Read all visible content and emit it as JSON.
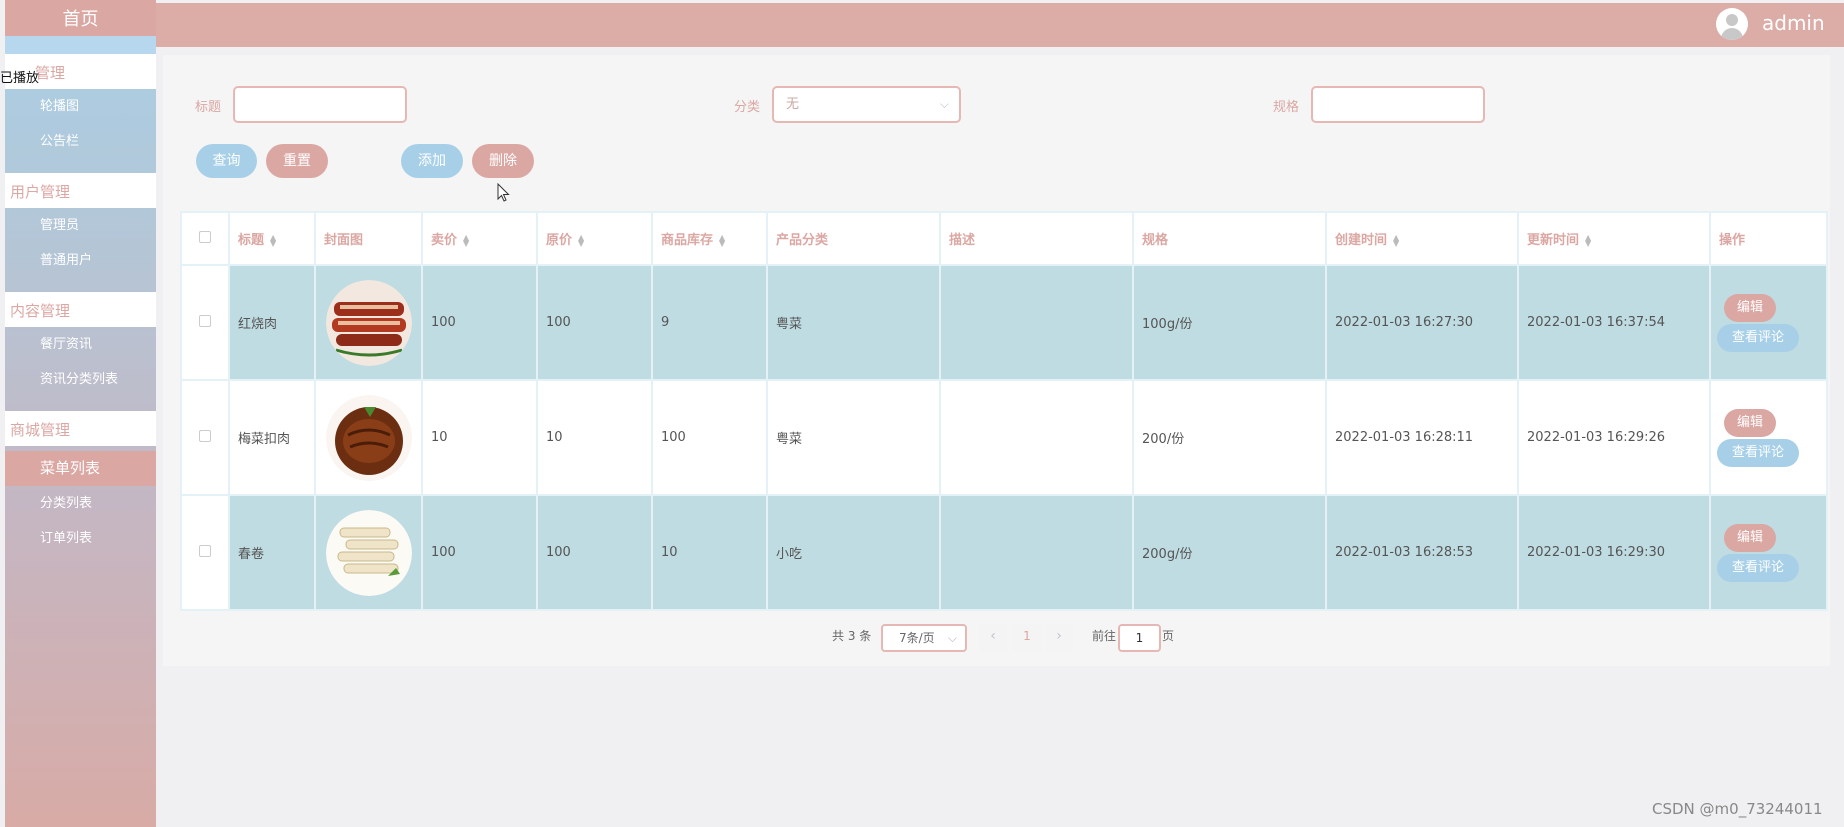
{
  "sidebar": {
    "home": "首页",
    "overlay_text": "已播放",
    "groups": [
      {
        "label": "管理",
        "items": [
          "轮播图",
          "公告栏"
        ]
      },
      {
        "label": "用户管理",
        "items": [
          "管理员",
          "普通用户"
        ]
      },
      {
        "label": "内容管理",
        "items": [
          "餐厅资讯",
          "资讯分类列表"
        ]
      },
      {
        "label": "商城管理",
        "items": [
          "菜单列表",
          "分类列表",
          "订单列表"
        ]
      }
    ],
    "active_item": "菜单列表"
  },
  "header": {
    "username": "admin"
  },
  "filters": {
    "title_label": "标题",
    "title_value": "",
    "category_label": "分类",
    "category_value": "无",
    "spec_label": "规格",
    "spec_value": ""
  },
  "buttons": {
    "query": "查询",
    "reset": "重置",
    "add": "添加",
    "delete": "删除"
  },
  "table": {
    "columns": [
      "标题",
      "封面图",
      "卖价",
      "原价",
      "商品库存",
      "产品分类",
      "描述",
      "规格",
      "创建时间",
      "更新时间",
      "操作"
    ],
    "rows": [
      {
        "title": "红烧肉",
        "sell_price": "100",
        "orig_price": "100",
        "stock": "9",
        "category": "粤菜",
        "desc": "",
        "spec": "100g/份",
        "created": "2022-01-03 16:27:30",
        "updated": "2022-01-03 16:37:54"
      },
      {
        "title": "梅菜扣肉",
        "sell_price": "10",
        "orig_price": "10",
        "stock": "100",
        "category": "粤菜",
        "desc": "",
        "spec": "200/份",
        "created": "2022-01-03 16:28:11",
        "updated": "2022-01-03 16:29:26"
      },
      {
        "title": "春卷",
        "sell_price": "100",
        "orig_price": "100",
        "stock": "10",
        "category": "小吃",
        "desc": "",
        "spec": "200g/份",
        "created": "2022-01-03 16:28:53",
        "updated": "2022-01-03 16:29:30"
      }
    ],
    "edit_label": "编辑",
    "view_comments_label": "查看评论"
  },
  "pagination": {
    "total_text": "共 3 条",
    "page_size": "7条/页",
    "current_page": "1",
    "goto_label": "前往",
    "goto_value": "1",
    "page_suffix": "页"
  },
  "watermark": "CSDN @m0_73244011",
  "colors": {
    "accent_pink": "#dba7a3",
    "accent_blue": "#a7d0e8",
    "row_highlight": "#bfdce2"
  }
}
